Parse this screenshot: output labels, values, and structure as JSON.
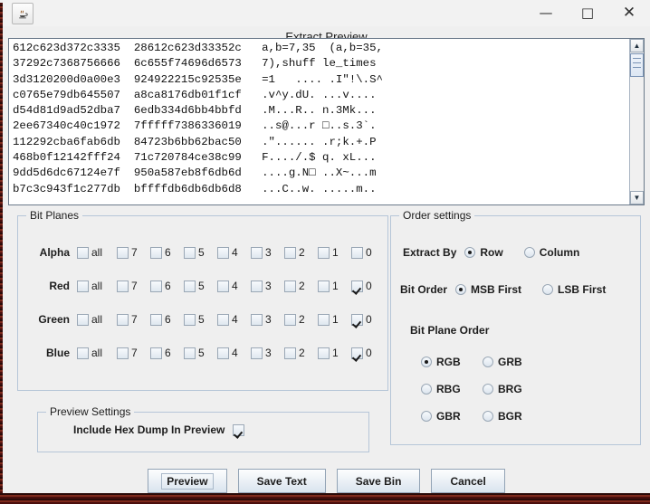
{
  "window": {
    "app_icon": "java-coffee-cup-icon",
    "minimize_label": "—",
    "maximize_label": "□",
    "close_label": "✕",
    "dialog_title": "Extract Preview"
  },
  "preview": {
    "hexdump": "612c623d372c3335  28612c623d33352c   a,b=7,35  (a,b=35,\n37292c7368756666  6c655f74696d6573   7),shuff le_times\n3d3120200d0a00e3  924922215c92535e   =1   .... .I\"!\\.S^\nc0765e79db645507  a8ca8176db01f1cf   .v^y.dU. ...v....\nd54d81d9ad52dba7  6edb334d6bb4bbfd   .M...R.. n.3Mk...\n2ee67340c40c1972  7fffff7386336019   ..s@...r □..s.3`.\n112292cba6fab6db  84723b6bb62bac50   .\"...... .r;k.+.P\n468b0f12142fff24  71c720784ce38c99   F..../.$ q. xL...\n9dd5d6dc67124e7f  950a587eb8f6db6d   ....g.N□ ..X~...m\nb7c3c943f1c277db  bffffdb6db6db6d8   ...C..w. .....m..",
    "scroll_up_icon": "scroll-up-arrow-icon",
    "scroll_down_icon": "scroll-down-arrow-icon"
  },
  "bit_planes": {
    "title": "Bit Planes",
    "columns": [
      "all",
      "7",
      "6",
      "5",
      "4",
      "3",
      "2",
      "1",
      "0"
    ],
    "rows": [
      {
        "label": "Alpha",
        "checked": [
          false,
          false,
          false,
          false,
          false,
          false,
          false,
          false,
          false
        ]
      },
      {
        "label": "Red",
        "checked": [
          false,
          false,
          false,
          false,
          false,
          false,
          false,
          false,
          true
        ]
      },
      {
        "label": "Green",
        "checked": [
          false,
          false,
          false,
          false,
          false,
          false,
          false,
          false,
          true
        ]
      },
      {
        "label": "Blue",
        "checked": [
          false,
          false,
          false,
          false,
          false,
          false,
          false,
          false,
          true
        ]
      }
    ]
  },
  "order_settings": {
    "title": "Order settings",
    "extract_by_label": "Extract By",
    "extract_by_options": [
      "Row",
      "Column"
    ],
    "extract_by_selected": "Row",
    "bit_order_label": "Bit Order",
    "bit_order_options": [
      "MSB First",
      "LSB First"
    ],
    "bit_order_selected": "MSB First",
    "bit_plane_order_label": "Bit Plane Order",
    "bit_plane_order_options": [
      "RGB",
      "GRB",
      "RBG",
      "BRG",
      "GBR",
      "BGR"
    ],
    "bit_plane_order_selected": "RGB"
  },
  "preview_settings": {
    "title": "Preview Settings",
    "include_hex_dump_label": "Include Hex Dump In Preview",
    "include_hex_dump_checked": true
  },
  "buttons": {
    "preview": "Preview",
    "save_text": "Save Text",
    "save_bin": "Save Bin",
    "cancel": "Cancel",
    "focused": "Preview"
  },
  "colors": {
    "dialog_bg": "#efefef",
    "panel_border": "#b6c6d8",
    "text": "#1d1d1d",
    "textarea_bg": "#ffffff",
    "backdrop": "#5a1512"
  }
}
